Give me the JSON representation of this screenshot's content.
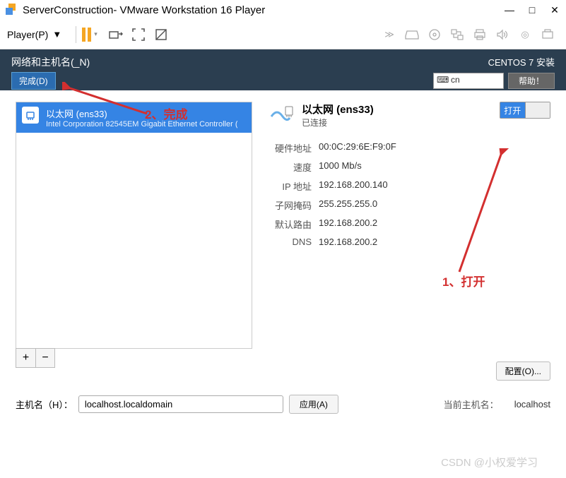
{
  "window": {
    "title": "ServerConstruction- VMware Workstation 16 Player"
  },
  "player_bar": {
    "menu_label": "Player(P)"
  },
  "header": {
    "title": "网络和主机名(_N)",
    "done_label": "完成(D)",
    "install_title": "CENTOS 7 安装",
    "keyboard": "cn",
    "help_label": "帮助！"
  },
  "annotations": {
    "step2": "2、完成",
    "step1": "1、打开"
  },
  "device_list": {
    "items": [
      {
        "name": "以太网 (ens33)",
        "desc": "Intel Corporation 82545EM Gigabit Ethernet Controller ("
      }
    ],
    "add_label": "+",
    "remove_label": "−"
  },
  "detail": {
    "title": "以太网 (ens33)",
    "status": "已连接",
    "toggle_on": "打开",
    "rows": {
      "hw_addr_label": "硬件地址",
      "hw_addr": "00:0C:29:6E:F9:0F",
      "speed_label": "速度",
      "speed": "1000 Mb/s",
      "ip_label": "IP 地址",
      "ip": "192.168.200.140",
      "netmask_label": "子网掩码",
      "netmask": "255.255.255.0",
      "gateway_label": "默认路由",
      "gateway": "192.168.200.2",
      "dns_label": "DNS",
      "dns": "192.168.200.2"
    },
    "config_label": "配置(O)..."
  },
  "hostname": {
    "label": "主机名（H）：",
    "value": "localhost.localdomain",
    "apply_label": "应用(A)",
    "current_label": "当前主机名：",
    "current_value": "localhost"
  },
  "watermark": "CSDN @小权爱学习"
}
